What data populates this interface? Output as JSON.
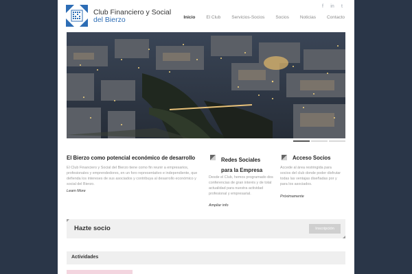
{
  "header": {
    "logo_line1": "Club Financiero y Social",
    "logo_line2": "del Bierzo",
    "social_icons": [
      "facebook-icon",
      "linkedin-icon",
      "twitter-icon"
    ],
    "nav": [
      {
        "label": "Inicio",
        "active": true
      },
      {
        "label": "El Club",
        "active": false
      },
      {
        "label": "Servicios-Socios",
        "active": false
      },
      {
        "label": "Socios",
        "active": false
      },
      {
        "label": "Noticias",
        "active": false
      },
      {
        "label": "Contacto",
        "active": false
      }
    ]
  },
  "hero": {
    "slides": 3,
    "active_slide": 1
  },
  "columns": {
    "col1": {
      "title": "El Bierzo como potencial económico de desarrollo",
      "text": "El Club Financiero y Social del Bierzo tiene como fin reunir a empresarios, profesionales y emprendedores, en un foro representativo e independiente, que defienda los intereses de sus asociados y contribuya al desarrollo económico y social del Bierzo.",
      "link": "Learn More"
    },
    "col2": {
      "title_line1": "Redes Sociales",
      "title_line2": "para la Empresa",
      "text": "Desde el Club, hemos programado dos conferencias de gran interés y de total actualidad para nuestra actividad profesional y empresarial.",
      "link": "Ampliar info"
    },
    "col3": {
      "title": "Acceso Socios",
      "text": "Accede al área restringida para socios del club donde poder disfrutar todas las ventajas diseñadas por y para los asociados.",
      "link": "Próximamente"
    }
  },
  "join": {
    "title": "Hazte socio",
    "button": "Inscripción"
  },
  "activities": {
    "title": "Actividades"
  },
  "colors": {
    "background": "#2a3648",
    "brand_blue": "#2d6db5",
    "panel": "#f0f0f0"
  }
}
